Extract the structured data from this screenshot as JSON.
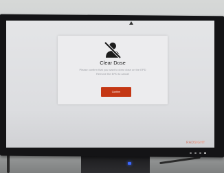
{
  "dialog": {
    "icon": "no-dose-person-icon",
    "title": "Clear Dose",
    "message_lines": [
      "Please confirm that you want to clear dose on the EPD",
      "Remove the EPD to cancel"
    ],
    "confirm_label": "Confirm"
  },
  "branding": {
    "prefix": "RAD",
    "suffix": "SIGHT"
  },
  "colors": {
    "accent": "#c43714",
    "screen_bg": "#e4e5e7",
    "dialog_bg": "#ececee"
  }
}
